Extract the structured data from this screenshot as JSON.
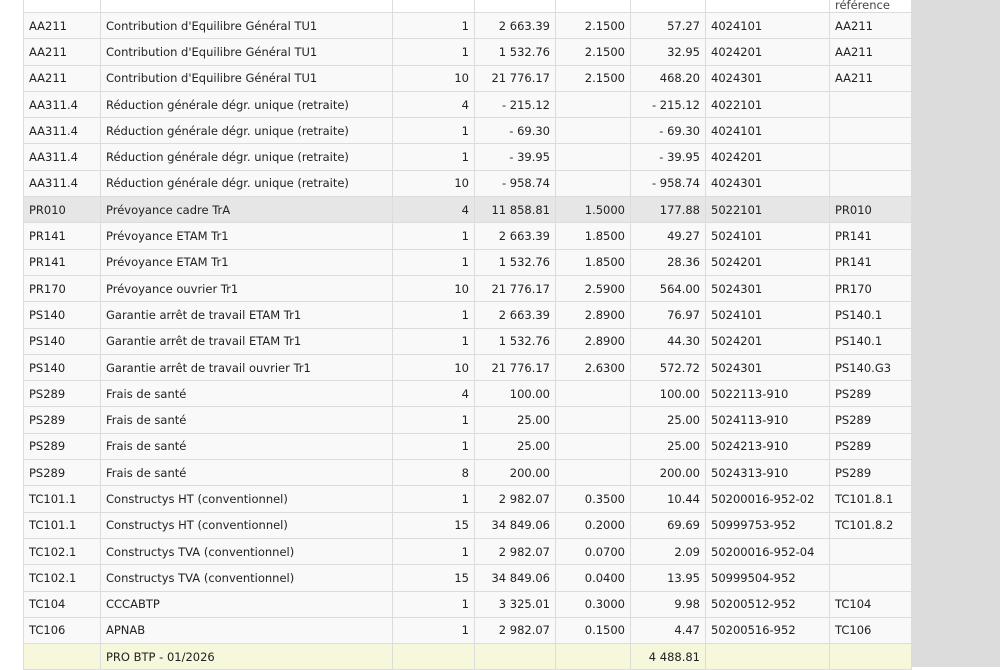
{
  "header": {
    "reference": "référence"
  },
  "rows": [
    [
      "AA211",
      "Contribution d'Equilibre Général TU1",
      "1",
      "2 663.39",
      "2.1500",
      "57.27",
      "4024101",
      "AA211"
    ],
    [
      "AA211",
      "Contribution d'Equilibre Général TU1",
      "1",
      "1 532.76",
      "2.1500",
      "32.95",
      "4024201",
      "AA211"
    ],
    [
      "AA211",
      "Contribution d'Equilibre Général TU1",
      "10",
      "21 776.17",
      "2.1500",
      "468.20",
      "4024301",
      "AA211"
    ],
    [
      "AA311.4",
      "Réduction générale dégr. unique (retraite)",
      "4",
      "- 215.12",
      "",
      "- 215.12",
      "4022101",
      ""
    ],
    [
      "AA311.4",
      "Réduction générale dégr. unique (retraite)",
      "1",
      "- 69.30",
      "",
      "- 69.30",
      "4024101",
      ""
    ],
    [
      "AA311.4",
      "Réduction générale dégr. unique (retraite)",
      "1",
      "- 39.95",
      "",
      "- 39.95",
      "4024201",
      ""
    ],
    [
      "AA311.4",
      "Réduction générale dégr. unique (retraite)",
      "10",
      "- 958.74",
      "",
      "- 958.74",
      "4024301",
      ""
    ],
    [
      "PR010",
      "Prévoyance cadre TrA",
      "4",
      "11 858.81",
      "1.5000",
      "177.88",
      "5022101",
      "PR010"
    ],
    [
      "PR141",
      "Prévoyance ETAM Tr1",
      "1",
      "2 663.39",
      "1.8500",
      "49.27",
      "5024101",
      "PR141"
    ],
    [
      "PR141",
      "Prévoyance ETAM Tr1",
      "1",
      "1 532.76",
      "1.8500",
      "28.36",
      "5024201",
      "PR141"
    ],
    [
      "PR170",
      "Prévoyance ouvrier Tr1",
      "10",
      "21 776.17",
      "2.5900",
      "564.00",
      "5024301",
      "PR170"
    ],
    [
      "PS140",
      "Garantie arrêt de travail ETAM Tr1",
      "1",
      "2 663.39",
      "2.8900",
      "76.97",
      "5024101",
      "PS140.1"
    ],
    [
      "PS140",
      "Garantie arrêt de travail ETAM Tr1",
      "1",
      "1 532.76",
      "2.8900",
      "44.30",
      "5024201",
      "PS140.1"
    ],
    [
      "PS140",
      "Garantie arrêt de travail ouvrier Tr1",
      "10",
      "21 776.17",
      "2.6300",
      "572.72",
      "5024301",
      "PS140.G3"
    ],
    [
      "PS289",
      "Frais de santé",
      "4",
      "100.00",
      "",
      "100.00",
      "5022113-910",
      "PS289"
    ],
    [
      "PS289",
      "Frais de santé",
      "1",
      "25.00",
      "",
      "25.00",
      "5024113-910",
      "PS289"
    ],
    [
      "PS289",
      "Frais de santé",
      "1",
      "25.00",
      "",
      "25.00",
      "5024213-910",
      "PS289"
    ],
    [
      "PS289",
      "Frais de santé",
      "8",
      "200.00",
      "",
      "200.00",
      "5024313-910",
      "PS289"
    ],
    [
      "TC101.1",
      "Constructys HT (conventionnel)",
      "1",
      "2 982.07",
      "0.3500",
      "10.44",
      "50200016-952-02",
      "TC101.8.1"
    ],
    [
      "TC101.1",
      "Constructys HT (conventionnel)",
      "15",
      "34 849.06",
      "0.2000",
      "69.69",
      "50999753-952",
      "TC101.8.2"
    ],
    [
      "TC102.1",
      "Constructys TVA (conventionnel)",
      "1",
      "2 982.07",
      "0.0700",
      "2.09",
      "50200016-952-04",
      ""
    ],
    [
      "TC102.1",
      "Constructys TVA (conventionnel)",
      "15",
      "34 849.06",
      "0.0400",
      "13.95",
      "50999504-952",
      ""
    ],
    [
      "TC104",
      "CCCABTP",
      "1",
      "3 325.01",
      "0.3000",
      "9.98",
      "50200512-952",
      "TC104"
    ],
    [
      "TC106",
      "APNAB",
      "1",
      "2 982.07",
      "0.1500",
      "4.47",
      "50200516-952",
      "TC106"
    ]
  ],
  "highlighted_row": 7,
  "total": {
    "label": "PRO BTP - 01/2026",
    "amount": "4 488.81"
  }
}
